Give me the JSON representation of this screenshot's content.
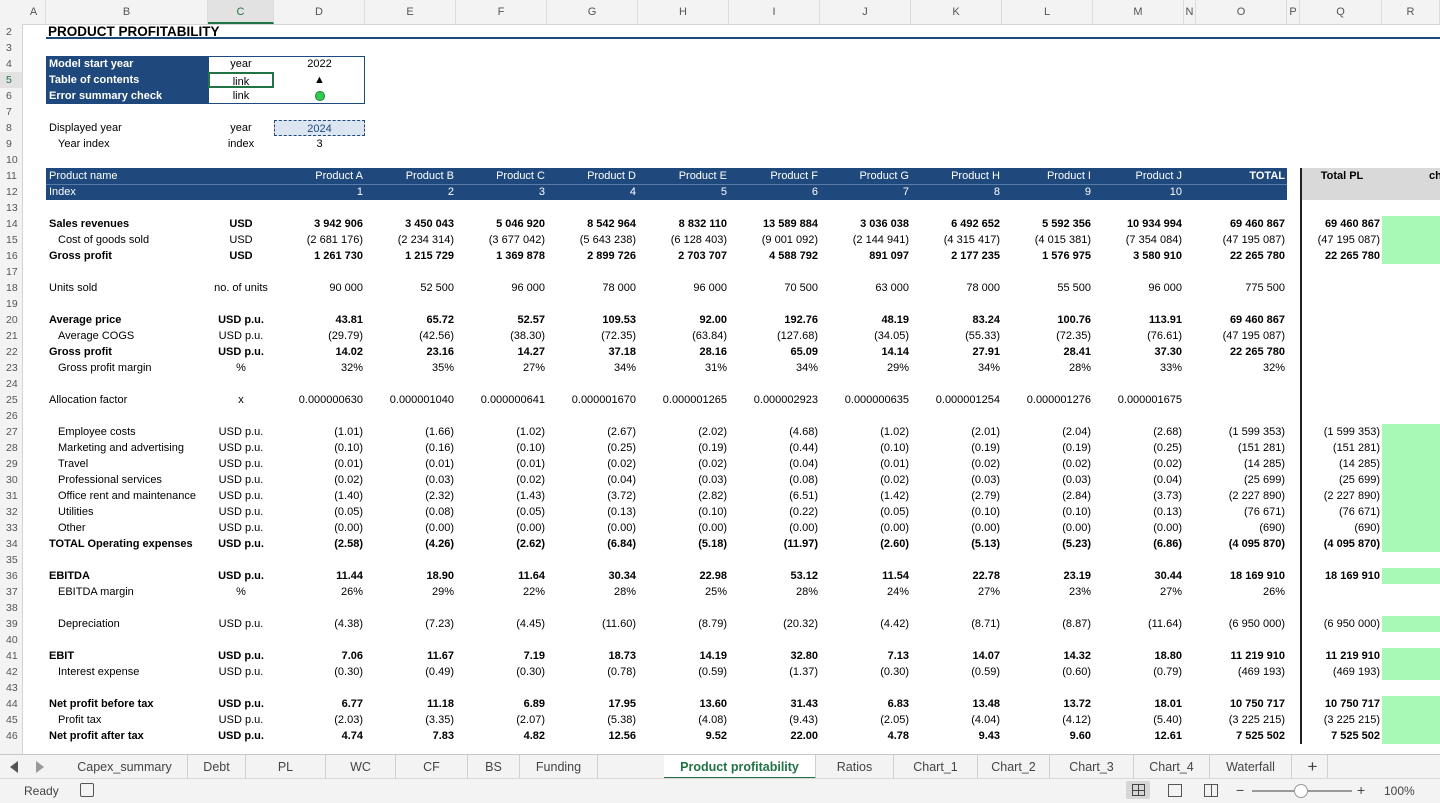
{
  "columns": [
    "A",
    "B",
    "C",
    "D",
    "E",
    "F",
    "G",
    "H",
    "I",
    "J",
    "K",
    "L",
    "M",
    "N",
    "O",
    "P",
    "Q",
    "R"
  ],
  "selected_column": "C",
  "rows": [
    2,
    3,
    4,
    5,
    6,
    7,
    8,
    9,
    10,
    11,
    12,
    13,
    14,
    15,
    16,
    17,
    18,
    19,
    20,
    21,
    22,
    23,
    24,
    25,
    26,
    27,
    28,
    29,
    30,
    31,
    32,
    33,
    34,
    35,
    36,
    37,
    38,
    39,
    40,
    41,
    42,
    43,
    44,
    45,
    46
  ],
  "selected_row": 5,
  "title": "PRODUCT PROFITABILITY",
  "model_info": [
    {
      "label": "Model start year",
      "unit": "year",
      "value": "2022"
    },
    {
      "label": "Table of contents",
      "unit": "link",
      "value": "▲"
    },
    {
      "label": "Error summary check",
      "unit": "link",
      "value": ""
    }
  ],
  "displayed_year": {
    "label": "Displayed year",
    "unit": "year",
    "value": "2024"
  },
  "year_index": {
    "label": "Year index",
    "unit": "index",
    "value": "3"
  },
  "header": {
    "name_label": "Product name",
    "index_label": "Index",
    "products": [
      "Product A",
      "Product B",
      "Product C",
      "Product D",
      "Product E",
      "Product F",
      "Product G",
      "Product H",
      "Product I",
      "Product J"
    ],
    "indices": [
      "1",
      "2",
      "3",
      "4",
      "5",
      "6",
      "7",
      "8",
      "9",
      "10"
    ],
    "total_label": "TOTAL",
    "total_pl_label": "Total PL",
    "check_label": "ch"
  },
  "table_rows": [
    {
      "row": 14,
      "label": "Sales revenues",
      "unit": "USD",
      "bold": true,
      "indent": false,
      "values": [
        "3 942 906",
        "3 450 043",
        "5 046 920",
        "8 542 964",
        "8 832 110",
        "13 589 884",
        "3 036 038",
        "6 492 652",
        "5 592 356",
        "10 934 994"
      ],
      "total": "69 460 867",
      "pl": "69 460 867",
      "green": true
    },
    {
      "row": 15,
      "label": "Cost of goods sold",
      "unit": "USD",
      "bold": false,
      "indent": true,
      "values": [
        "(2 681 176)",
        "(2 234 314)",
        "(3 677 042)",
        "(5 643 238)",
        "(6 128 403)",
        "(9 001 092)",
        "(2 144 941)",
        "(4 315 417)",
        "(4 015 381)",
        "(7 354 084)"
      ],
      "total": "(47 195 087)",
      "pl": "(47 195 087)",
      "green": true
    },
    {
      "row": 16,
      "label": "Gross profit",
      "unit": "USD",
      "bold": true,
      "indent": false,
      "values": [
        "1 261 730",
        "1 215 729",
        "1 369 878",
        "2 899 726",
        "2 703 707",
        "4 588 792",
        "891 097",
        "2 177 235",
        "1 576 975",
        "3 580 910"
      ],
      "total": "22 265 780",
      "pl": "22 265 780",
      "green": true
    },
    {
      "row": 18,
      "label": "Units sold",
      "unit": "no. of units",
      "bold": false,
      "indent": false,
      "values": [
        "90 000",
        "52 500",
        "96 000",
        "78 000",
        "96 000",
        "70 500",
        "63 000",
        "78 000",
        "55 500",
        "96 000"
      ],
      "total": "775 500",
      "pl": "",
      "green": false
    },
    {
      "row": 20,
      "label": "Average price",
      "unit": "USD p.u.",
      "bold": true,
      "indent": false,
      "values": [
        "43.81",
        "65.72",
        "52.57",
        "109.53",
        "92.00",
        "192.76",
        "48.19",
        "83.24",
        "100.76",
        "113.91"
      ],
      "total": "69 460 867",
      "pl": "",
      "green": false
    },
    {
      "row": 21,
      "label": "Average COGS",
      "unit": "USD p.u.",
      "bold": false,
      "indent": true,
      "values": [
        "(29.79)",
        "(42.56)",
        "(38.30)",
        "(72.35)",
        "(63.84)",
        "(127.68)",
        "(34.05)",
        "(55.33)",
        "(72.35)",
        "(76.61)"
      ],
      "total": "(47 195 087)",
      "pl": "",
      "green": false
    },
    {
      "row": 22,
      "label": "Gross profit",
      "unit": "USD p.u.",
      "bold": true,
      "indent": false,
      "values": [
        "14.02",
        "23.16",
        "14.27",
        "37.18",
        "28.16",
        "65.09",
        "14.14",
        "27.91",
        "28.41",
        "37.30"
      ],
      "total": "22 265 780",
      "pl": "",
      "green": false
    },
    {
      "row": 23,
      "label": "Gross profit margin",
      "unit": "%",
      "bold": false,
      "indent": true,
      "values": [
        "32%",
        "35%",
        "27%",
        "34%",
        "31%",
        "34%",
        "29%",
        "34%",
        "28%",
        "33%"
      ],
      "total": "32%",
      "pl": "",
      "green": false
    },
    {
      "row": 25,
      "label": "Allocation factor",
      "unit": "x",
      "bold": false,
      "indent": false,
      "values": [
        "0.000000630",
        "0.000001040",
        "0.000000641",
        "0.000001670",
        "0.000001265",
        "0.000002923",
        "0.000000635",
        "0.000001254",
        "0.000001276",
        "0.000001675"
      ],
      "total": "",
      "pl": "",
      "green": false
    },
    {
      "row": 27,
      "label": "Employee costs",
      "unit": "USD p.u.",
      "bold": false,
      "indent": true,
      "values": [
        "(1.01)",
        "(1.66)",
        "(1.02)",
        "(2.67)",
        "(2.02)",
        "(4.68)",
        "(1.02)",
        "(2.01)",
        "(2.04)",
        "(2.68)"
      ],
      "total": "(1 599 353)",
      "pl": "(1 599 353)",
      "green": true
    },
    {
      "row": 28,
      "label": "Marketing and advertising",
      "unit": "USD p.u.",
      "bold": false,
      "indent": true,
      "values": [
        "(0.10)",
        "(0.16)",
        "(0.10)",
        "(0.25)",
        "(0.19)",
        "(0.44)",
        "(0.10)",
        "(0.19)",
        "(0.19)",
        "(0.25)"
      ],
      "total": "(151 281)",
      "pl": "(151 281)",
      "green": true
    },
    {
      "row": 29,
      "label": "Travel",
      "unit": "USD p.u.",
      "bold": false,
      "indent": true,
      "values": [
        "(0.01)",
        "(0.01)",
        "(0.01)",
        "(0.02)",
        "(0.02)",
        "(0.04)",
        "(0.01)",
        "(0.02)",
        "(0.02)",
        "(0.02)"
      ],
      "total": "(14 285)",
      "pl": "(14 285)",
      "green": true
    },
    {
      "row": 30,
      "label": "Professional services",
      "unit": "USD p.u.",
      "bold": false,
      "indent": true,
      "values": [
        "(0.02)",
        "(0.03)",
        "(0.02)",
        "(0.04)",
        "(0.03)",
        "(0.08)",
        "(0.02)",
        "(0.03)",
        "(0.03)",
        "(0.04)"
      ],
      "total": "(25 699)",
      "pl": "(25 699)",
      "green": true
    },
    {
      "row": 31,
      "label": "Office rent and maintenance",
      "unit": "USD p.u.",
      "bold": false,
      "indent": true,
      "values": [
        "(1.40)",
        "(2.32)",
        "(1.43)",
        "(3.72)",
        "(2.82)",
        "(6.51)",
        "(1.42)",
        "(2.79)",
        "(2.84)",
        "(3.73)"
      ],
      "total": "(2 227 890)",
      "pl": "(2 227 890)",
      "green": true
    },
    {
      "row": 32,
      "label": "Utilities",
      "unit": "USD p.u.",
      "bold": false,
      "indent": true,
      "values": [
        "(0.05)",
        "(0.08)",
        "(0.05)",
        "(0.13)",
        "(0.10)",
        "(0.22)",
        "(0.05)",
        "(0.10)",
        "(0.10)",
        "(0.13)"
      ],
      "total": "(76 671)",
      "pl": "(76 671)",
      "green": true
    },
    {
      "row": 33,
      "label": "Other",
      "unit": "USD p.u.",
      "bold": false,
      "indent": true,
      "values": [
        "(0.00)",
        "(0.00)",
        "(0.00)",
        "(0.00)",
        "(0.00)",
        "(0.00)",
        "(0.00)",
        "(0.00)",
        "(0.00)",
        "(0.00)"
      ],
      "total": "(690)",
      "pl": "(690)",
      "green": true
    },
    {
      "row": 34,
      "label": "TOTAL Operating expenses",
      "unit": "USD p.u.",
      "bold": true,
      "indent": false,
      "values": [
        "(2.58)",
        "(4.26)",
        "(2.62)",
        "(6.84)",
        "(5.18)",
        "(11.97)",
        "(2.60)",
        "(5.13)",
        "(5.23)",
        "(6.86)"
      ],
      "total": "(4 095 870)",
      "pl": "(4 095 870)",
      "green": true
    },
    {
      "row": 36,
      "label": "EBITDA",
      "unit": "USD p.u.",
      "bold": true,
      "indent": false,
      "values": [
        "11.44",
        "18.90",
        "11.64",
        "30.34",
        "22.98",
        "53.12",
        "11.54",
        "22.78",
        "23.19",
        "30.44"
      ],
      "total": "18 169 910",
      "pl": "18 169 910",
      "green": true
    },
    {
      "row": 37,
      "label": "EBITDA margin",
      "unit": "%",
      "bold": false,
      "indent": true,
      "values": [
        "26%",
        "29%",
        "22%",
        "28%",
        "25%",
        "28%",
        "24%",
        "27%",
        "23%",
        "27%"
      ],
      "total": "26%",
      "pl": "",
      "green": false
    },
    {
      "row": 39,
      "label": "Depreciation",
      "unit": "USD p.u.",
      "bold": false,
      "indent": true,
      "values": [
        "(4.38)",
        "(7.23)",
        "(4.45)",
        "(11.60)",
        "(8.79)",
        "(20.32)",
        "(4.42)",
        "(8.71)",
        "(8.87)",
        "(11.64)"
      ],
      "total": "(6 950 000)",
      "pl": "(6 950 000)",
      "green": true
    },
    {
      "row": 41,
      "label": "EBIT",
      "unit": "USD p.u.",
      "bold": true,
      "indent": false,
      "values": [
        "7.06",
        "11.67",
        "7.19",
        "18.73",
        "14.19",
        "32.80",
        "7.13",
        "14.07",
        "14.32",
        "18.80"
      ],
      "total": "11 219 910",
      "pl": "11 219 910",
      "green": true
    },
    {
      "row": 42,
      "label": "Interest expense",
      "unit": "USD p.u.",
      "bold": false,
      "indent": true,
      "values": [
        "(0.30)",
        "(0.49)",
        "(0.30)",
        "(0.78)",
        "(0.59)",
        "(1.37)",
        "(0.30)",
        "(0.59)",
        "(0.60)",
        "(0.79)"
      ],
      "total": "(469 193)",
      "pl": "(469 193)",
      "green": true
    },
    {
      "row": 44,
      "label": "Net profit before tax",
      "unit": "USD p.u.",
      "bold": true,
      "indent": false,
      "values": [
        "6.77",
        "11.18",
        "6.89",
        "17.95",
        "13.60",
        "31.43",
        "6.83",
        "13.48",
        "13.72",
        "18.01"
      ],
      "total": "10 750 717",
      "pl": "10 750 717",
      "green": true
    },
    {
      "row": 45,
      "label": "Profit tax",
      "unit": "USD p.u.",
      "bold": false,
      "indent": true,
      "values": [
        "(2.03)",
        "(3.35)",
        "(2.07)",
        "(5.38)",
        "(4.08)",
        "(9.43)",
        "(2.05)",
        "(4.04)",
        "(4.12)",
        "(5.40)"
      ],
      "total": "(3 225 215)",
      "pl": "(3 225 215)",
      "green": true
    },
    {
      "row": 46,
      "label": "Net profit after tax",
      "unit": "USD p.u.",
      "bold": true,
      "indent": false,
      "values": [
        "4.74",
        "7.83",
        "4.82",
        "12.56",
        "9.52",
        "22.00",
        "4.78",
        "9.43",
        "9.60",
        "12.61"
      ],
      "total": "7 525 502",
      "pl": "7 525 502",
      "green": true
    }
  ],
  "tabs": [
    "Capex_summary",
    "Debt",
    "PL",
    "WC",
    "CF",
    "BS",
    "Funding",
    "Product profitability",
    "Ratios",
    "Chart_1",
    "Chart_2",
    "Chart_3",
    "Chart_4",
    "Waterfall"
  ],
  "active_tab": "Product profitability",
  "add_sheet": "+",
  "status": {
    "ready": "Ready",
    "zoom": "100%",
    "zoom_minus": "−",
    "zoom_plus": "+"
  },
  "icons": {
    "nav_prev": "triangle-left-icon",
    "nav_next": "triangle-right-icon",
    "accessibility": "accessibility-icon",
    "normal_view": "grid-view-icon",
    "page_layout": "page-layout-icon",
    "page_break": "page-break-icon"
  },
  "colors": {
    "header_blue": "#1f497d",
    "check_green": "#a7f9b5",
    "ok_dot": "#2ecc52",
    "active_tab": "#217346"
  }
}
